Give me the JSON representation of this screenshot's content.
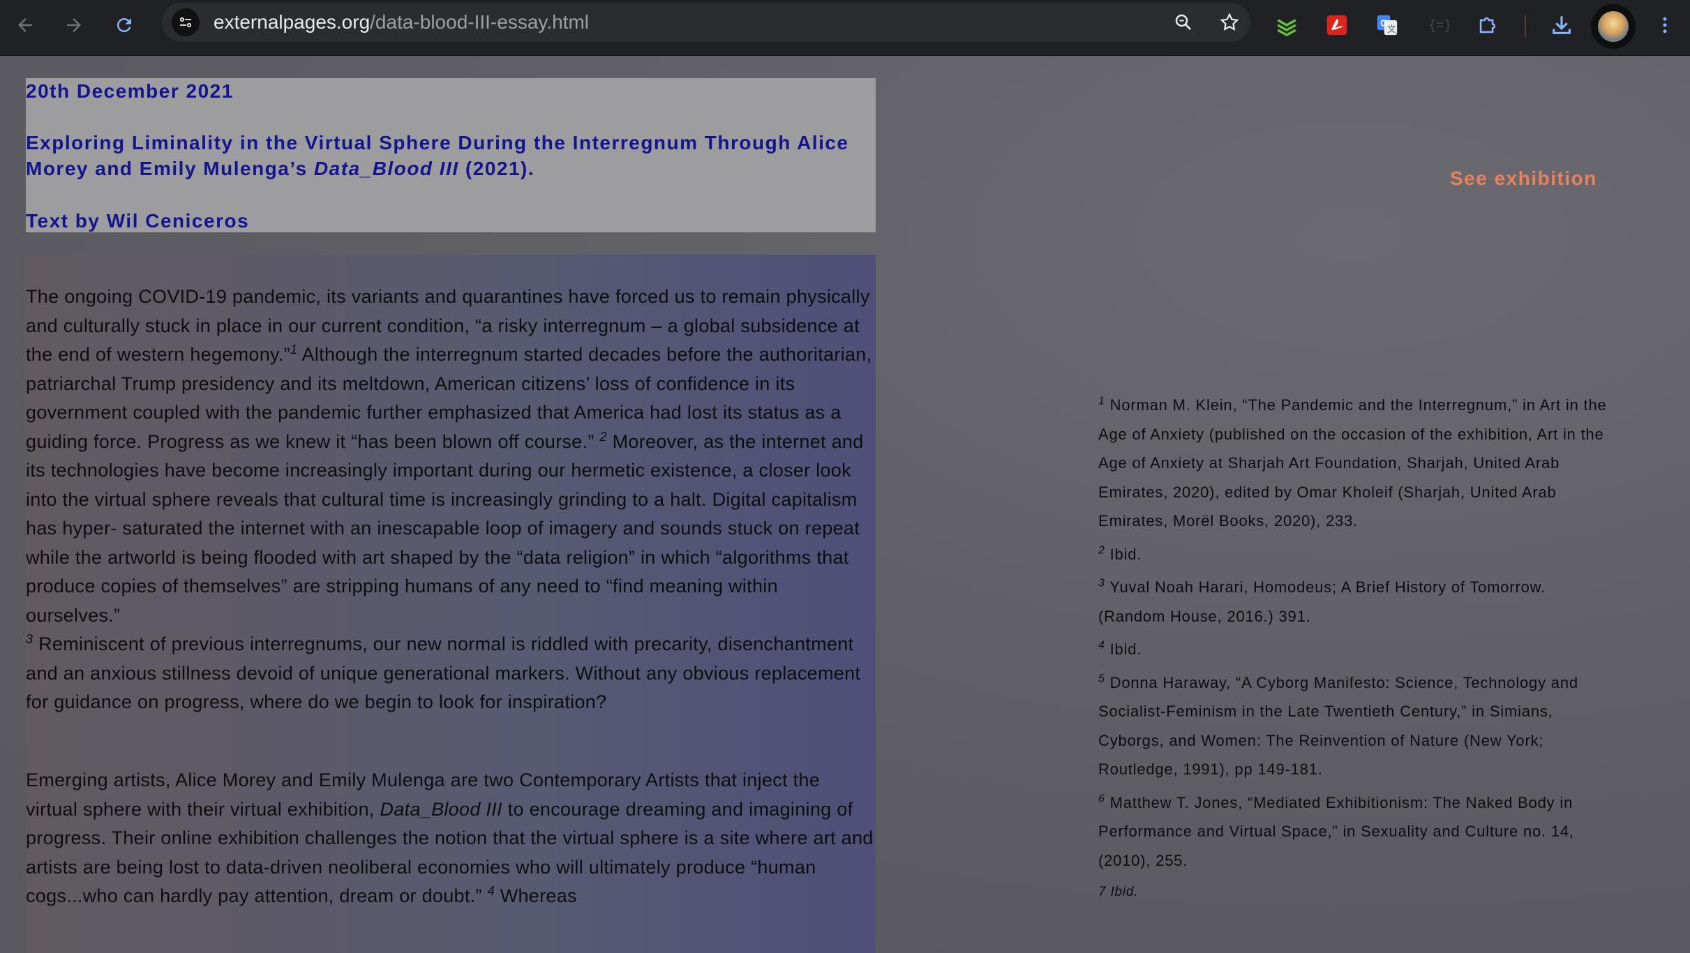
{
  "browser": {
    "url_host": "externalpages.org",
    "url_path": "/data-blood-III-essay.html",
    "icons": [
      "back-arrow-icon",
      "forward-arrow-icon",
      "reload-icon",
      "site-info-icon",
      "zoom-icon",
      "bookmark-star-icon",
      "layers-extension-icon",
      "pdf-extension-icon",
      "translate-extension-icon",
      "code-extension-icon",
      "puzzle-extensions-icon",
      "download-icon",
      "profile-avatar",
      "kebab-menu-icon"
    ]
  },
  "header": {
    "date": "20th December 2021",
    "title_part1": "Exploring Liminality in the Virtual Sphere During the Interregnum Through Alice Morey and Emily Mulenga’s ",
    "title_italic": "Data_Blood III",
    "title_part2": " (2021).",
    "author": "Text by Wil Ceniceros"
  },
  "see_exhibition": "See exhibition",
  "essay": {
    "p1_a": "The ongoing COVID-19 pandemic, its variants and quarantines have forced us to remain physically and culturally stuck in place in our current condition, “a risky interregnum – a global subsidence at the end of western hegemony.”",
    "p1_sup1": "1",
    "p1_b": " Although the interregnum started decades before the authoritarian, patriarchal Trump presidency and its meltdown, American citizens’ loss of confidence in its government coupled with the pandemic further emphasized that America had lost its status as a guiding force. Progress as we knew it “has been blown off course.” ",
    "p1_sup2": "2",
    "p1_c": " Moreover, as the internet and its technologies have become increasingly important during our hermetic existence, a closer look into the virtual sphere reveals that cultural time is increasingly grinding to a halt. Digital capitalism has hyper- saturated the internet with an inescapable loop of imagery and sounds stuck on repeat while the artworld is being flooded with art shaped by the “data religion” in which “algorithms that produce copies of themselves” are stripping humans of any need to “find meaning within ourselves.” ",
    "p1_sup3": "3",
    "p1_d": " Reminiscent of previous interregnums, our new normal is riddled with precarity, disenchantment and an anxious stillness devoid of unique generational markers. Without any obvious replacement for guidance on progress, where do we begin to look for inspiration?",
    "p2_a": "Emerging artists, Alice Morey and Emily Mulenga are two Contemporary Artists that inject the virtual sphere with their virtual exhibition, ",
    "p2_italic": "Data_Blood III",
    "p2_b": " to encourage dreaming and imagining of progress. Their online exhibition challenges the notion that the virtual sphere is a site where art and artists are being lost to data-driven neoliberal economies who will ultimately produce “human cogs...who can hardly pay attention, dream or doubt.” ",
    "p2_sup4": "4",
    "p2_c": " Whereas"
  },
  "footnotes": [
    {
      "num": "1",
      "text": "Norman M. Klein, “The Pandemic and the Interregnum,” in Art in the Age of Anxiety (published on the occasion of the exhibition, Art in the Age of Anxiety at Sharjah Art Foundation, Sharjah, United Arab Emirates, 2020), edited by Omar Kholeif (Sharjah, United Arab Emirates, Morël Books, 2020), 233."
    },
    {
      "num": "2",
      "text": "Ibid."
    },
    {
      "num": "3",
      "text": "Yuval Noah Harari, Homodeus; A Brief History of Tomorrow. (Random House, 2016.) 391."
    },
    {
      "num": "4",
      "text": "Ibid."
    },
    {
      "num": "5",
      "text": "Donna Haraway, “A Cyborg Manifesto: Science, Technology and Socialist-Feminism in the Late Twentieth Century,” in Simians, Cyborgs, and Women: The Reinvention of Nature (New York; Routledge, 1991), pp 149-181."
    },
    {
      "num": "6",
      "text": "Matthew T. Jones, “Mediated Exhibitionism: The Naked Body in Performance and Virtual Space,” in Sexuality and Culture no. 14, (2010), 255."
    }
  ],
  "footnote_last": "7 Ibid.",
  "colors": {
    "header_text": "#14148f",
    "accent_link": "#e9825a",
    "chrome_bg": "#202124"
  }
}
